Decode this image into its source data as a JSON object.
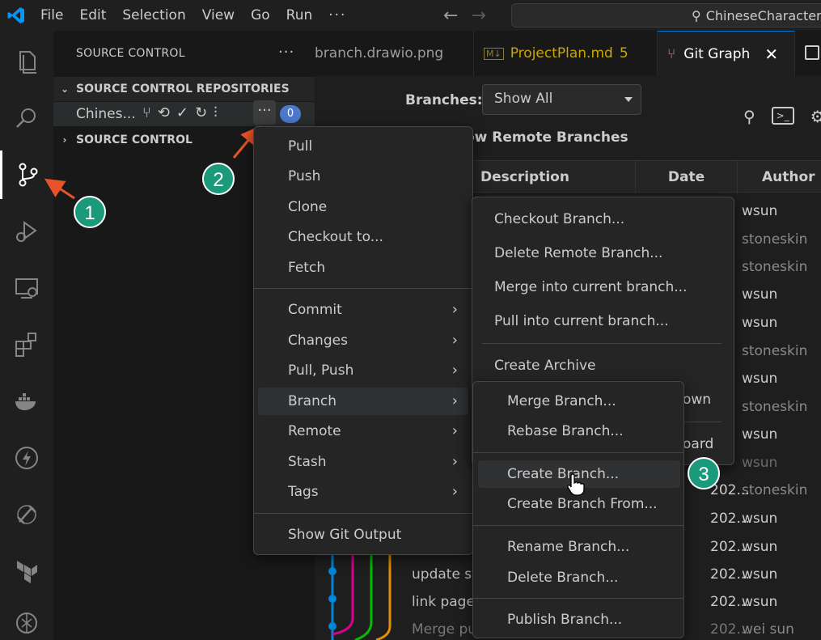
{
  "titlebar": {
    "menus": [
      "File",
      "Edit",
      "Selection",
      "View",
      "Go",
      "Run"
    ],
    "more": "···",
    "search_text": "ChineseCharacter"
  },
  "activity": [
    "files-icon",
    "search-icon",
    "source-control-icon",
    "run-debug-icon",
    "remote-explorer-icon",
    "extensions-icon",
    "docker-icon",
    "thunder-icon",
    "testing-icon",
    "terraform-icon",
    "chatgpt-icon"
  ],
  "sidebar": {
    "title": "SOURCE CONTROL",
    "dots": "···",
    "repos_section": "SOURCE CONTROL REPOSITORIES",
    "repo_name": "Chines...",
    "repo_badge": "0",
    "sc_section": "SOURCE CONTROL"
  },
  "tabs": [
    {
      "label": "branch.drawio.png"
    },
    {
      "label": "ProjectPlan.md",
      "badge": "5"
    },
    {
      "label": "Git Graph"
    }
  ],
  "gitgraph": {
    "branches_label": "Branches:",
    "branches_value": "Show All",
    "show_remote": "ow Remote Branches",
    "columns": [
      "Description",
      "Date",
      "Author"
    ],
    "authors": [
      "wsun",
      "stoneskin",
      "stoneskin",
      "wsun",
      "wsun",
      "stoneskin",
      "wsun",
      "stoneskin",
      "wsun",
      "wsun",
      "stoneskin",
      "wsun",
      "wsun",
      "wsun",
      "wsun",
      "wei sun"
    ],
    "dates": [
      "202...",
      "202...",
      "202...",
      "202...",
      "202...",
      "202..."
    ],
    "descs": [
      "update st",
      "link page",
      "Merge pu"
    ]
  },
  "menu1": {
    "group1": [
      "Pull",
      "Push",
      "Clone",
      "Checkout to...",
      "Fetch"
    ],
    "group2": [
      "Commit",
      "Changes",
      "Pull, Push",
      "Branch",
      "Remote",
      "Stash",
      "Tags"
    ],
    "group3": [
      "Show Git Output"
    ]
  },
  "menu2": {
    "items": [
      "Checkout Branch...",
      "Delete Remote Branch...",
      "Merge into current branch...",
      "Pull into current branch...",
      "Create Archive"
    ],
    "partial1": "own",
    "partial2": "oard"
  },
  "menu3": {
    "group1": [
      "Merge Branch...",
      "Rebase Branch..."
    ],
    "group2": [
      "Create Branch...",
      "Create Branch From..."
    ],
    "group3": [
      "Rename Branch...",
      "Delete Branch..."
    ],
    "group4": [
      "Publish Branch..."
    ]
  },
  "annotations": [
    "1",
    "2",
    "3"
  ],
  "colors": {
    "accent": "#0078d4",
    "annotation": "#1a9a7a",
    "arrow": "#e8532a",
    "badge": "#4d78cc"
  }
}
